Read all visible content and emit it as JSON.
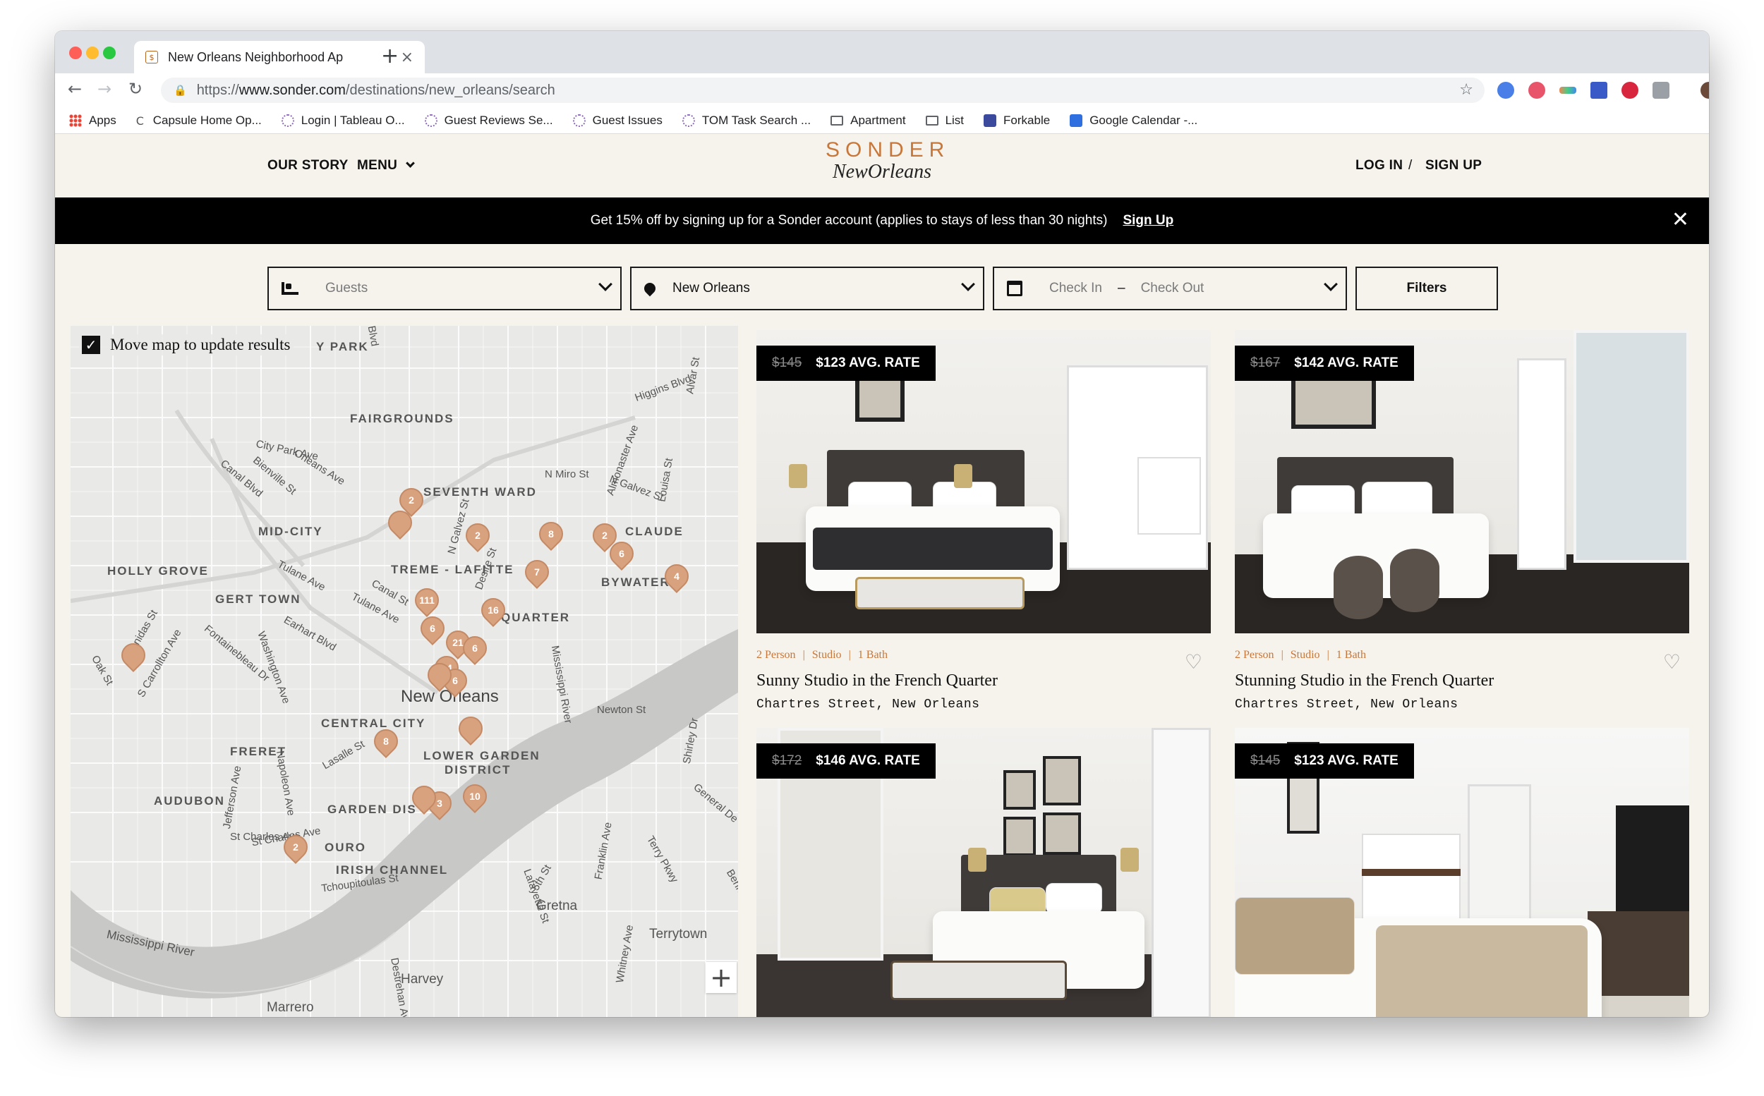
{
  "browser": {
    "tab_title": "New Orleans Neighborhood Ap",
    "tab_favicon": "$",
    "url_prefix": "https://",
    "url_domain": "www.sonder.com",
    "url_path": "/destinations/new_orleans/search",
    "bookmarks": [
      {
        "label": "Apps",
        "icon": "apps-grid-icon"
      },
      {
        "label": "Capsule Home Op...",
        "icon": "capsule-icon"
      },
      {
        "label": "Login | Tableau O...",
        "icon": "tableau-icon"
      },
      {
        "label": "Guest Reviews Se...",
        "icon": "tableau-icon"
      },
      {
        "label": "Guest Issues",
        "icon": "tableau-icon"
      },
      {
        "label": "TOM Task Search ...",
        "icon": "tableau-icon"
      },
      {
        "label": "Apartment",
        "icon": "folder-icon"
      },
      {
        "label": "List",
        "icon": "folder-icon"
      },
      {
        "label": "Forkable",
        "icon": "forkable-icon"
      },
      {
        "label": "Google Calendar -...",
        "icon": "calendar-icon"
      }
    ]
  },
  "header": {
    "our_story": "OUR STORY",
    "menu": "MENU",
    "logo_top": "SONDER",
    "logo_bottom": "NewOrleans",
    "log_in": "LOG IN",
    "divider": "/",
    "sign_up": "SIGN UP"
  },
  "promo": {
    "text": "Get 15% off by signing up for a Sonder account (applies to stays of less than 30 nights)",
    "link": "Sign Up"
  },
  "search": {
    "guests_placeholder": "Guests",
    "location_value": "New Orleans",
    "check_in_placeholder": "Check In",
    "dash": "–",
    "check_out_placeholder": "Check Out",
    "filters_label": "Filters"
  },
  "map": {
    "move_map_label": "Move map to update results",
    "zoom_in": "+",
    "neighborhoods": [
      {
        "label": "FAIRGROUNDS"
      },
      {
        "label": "SEVENTH WARD"
      },
      {
        "label": "MID-CITY"
      },
      {
        "label": "CLAUDE"
      },
      {
        "label": "HOLLY GROVE"
      },
      {
        "label": "TREME - LAFITTE"
      },
      {
        "label": "BYWATER"
      },
      {
        "label": "GERT TOWN"
      },
      {
        "label": "QUARTER"
      },
      {
        "label": "CENTRAL CITY"
      },
      {
        "label": "FRERET"
      },
      {
        "label": "LOWER GARDEN"
      },
      {
        "label": "DISTRICT"
      },
      {
        "label": "AUDUBON"
      },
      {
        "label": "GARDEN DIS"
      },
      {
        "label": "OURO"
      },
      {
        "label": "IRISH CHANNEL"
      },
      {
        "label": "Y PARK"
      }
    ],
    "city_labels": [
      {
        "label": "New Orleans"
      },
      {
        "label": "Gretna"
      },
      {
        "label": "Terrytown"
      },
      {
        "label": "Harvey"
      },
      {
        "label": "Marrero"
      }
    ],
    "street_labels": [
      "Mississippi River",
      "Mississippi River",
      "Tulane Ave",
      "Tulane Ave",
      "Canal St",
      "Earhart Blvd",
      "Fontainebleau Dr",
      "St Charles Ave",
      "Napoleon Ave",
      "Jefferson Ave",
      "Washington Ave",
      "S Carrollton Ave",
      "Leonidas St",
      "Oak St",
      "Lasalle St",
      "Tchoupitoulas St",
      "City Park Ave",
      "Orleans Ave",
      "Bienville St",
      "Canal Blvd",
      "N Miro St",
      "Almonaster Ave",
      "N Galvez St",
      "Higgins Blvd",
      "Louisa St",
      "Alvar St",
      "Franklin Ave",
      "General De Gaulle Dr",
      "Newton St",
      "Shirley Dr",
      "Terry Pkwy",
      "Whitney Ave",
      "Lafayette St",
      "5th St",
      "Behrman",
      "Destrehan Ave",
      "N Galvez St",
      "St Charles Ave",
      "Blvd",
      "Desire St"
    ],
    "markers": [
      "2",
      "",
      "2",
      "8",
      "2",
      "6",
      "4",
      "7",
      "111",
      "16",
      "6",
      "21",
      "6",
      "14",
      "6",
      "",
      "8",
      "",
      "3",
      "10",
      "",
      "2",
      ""
    ]
  },
  "listings": [
    {
      "old_price": "$145",
      "rate": "$123 AVG. RATE",
      "persons": "2 Person",
      "type": "Studio",
      "bath": "1 Bath",
      "title": "Sunny Studio in the French Quarter",
      "address": "Chartres Street, New Orleans"
    },
    {
      "old_price": "$167",
      "rate": "$142 AVG. RATE",
      "persons": "2 Person",
      "type": "Studio",
      "bath": "1 Bath",
      "title": "Stunning Studio in the French Quarter",
      "address": "Chartres Street, New Orleans"
    },
    {
      "old_price": "$172",
      "rate": "$146 AVG. RATE"
    },
    {
      "old_price": "$145",
      "rate": "$123 AVG. RATE"
    }
  ],
  "colors": {
    "accent": "#c8773a",
    "page_bg": "#f6f3ec",
    "banner_bg": "#000000",
    "marker": "#d9a27f"
  }
}
